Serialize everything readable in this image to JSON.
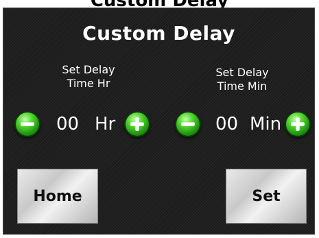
{
  "screen": {
    "title": "Custom Delay"
  },
  "hour": {
    "label_line1": "Set Delay",
    "label_line2": "Time Hr",
    "value": "00",
    "unit": "Hr"
  },
  "minute": {
    "label_line1": "Set Delay",
    "label_line2": "Time Min",
    "value": "00",
    "unit": "Min"
  },
  "buttons": {
    "home": "Home",
    "set": "Set"
  },
  "colors": {
    "panel_bg": "#1b1b1b",
    "button_green": "#2fb01f",
    "text": "#ffffff"
  },
  "icons": [
    "minus-icon",
    "plus-icon"
  ]
}
